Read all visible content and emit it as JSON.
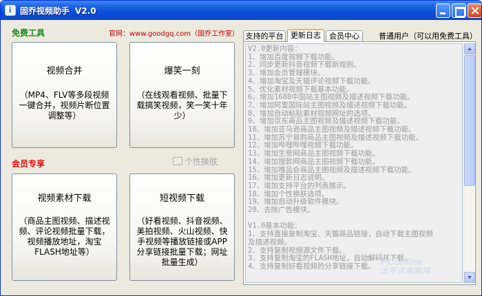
{
  "window": {
    "title": "固乔视频助手",
    "version": "V2.0"
  },
  "left": {
    "free_label": "免费工具",
    "site_text": "官网：www.goodgq.com（固乔工作室）",
    "vip_label": "会员专享",
    "skin_label": "个性换肤",
    "buttons": [
      {
        "title": "视频合并",
        "desc": "（MP4、FLV等多段视频一键合并，视频片断位置调整等）"
      },
      {
        "title": "爆笑一刻",
        "desc": "（在线观看视频、批量下载搞笑视频，笑一笑十年少）"
      },
      {
        "title": "视频素材下载",
        "desc": "（商品主图视频、描述视频、评论视频批量下载，视频播放地址，淘宝FLASH地址等）"
      },
      {
        "title": "短视频下载",
        "desc": "（好看视频、抖音视频、美拍视频、火山视频、快手视频等播放链接或APP分享链接批量下载；网址批量生成）"
      }
    ]
  },
  "tabs": [
    {
      "label": "支持的平台"
    },
    {
      "label": "更新日志"
    },
    {
      "label": "会员中心"
    }
  ],
  "user_status": "普通用户（可以用免费工具）",
  "changelog": [
    "V2.0更新内容：",
    "1、增加百度视频下载功能。",
    "2、同步更新抖音视频下载新规则。",
    "3、增加会员管理模块。",
    "4、增加淘宝及天猫评论视频下载功能。",
    "5、优化素材视频下载基本功能。",
    "6、增加1688中国站主图视频及描述视频下载功能。",
    "7、增加阿里国际站主图视频及描述视频下载功能。",
    "8、增加自动粘贴素材视频网址的选项。",
    "9、增加京东商品主图视频及描述视频下载功能。",
    "10、增加亚马逊商品主图视频及描述视频下载功能。",
    "11、增加苏宁易购商品主图视频及描述视频下载功能。",
    "12、增加哔哩哔哩视频下载功能。",
    "13、增加生意网商品主图视频下载功能。",
    "14、增加搜款网商品主图视频下载功能。",
    "15、增加唯品会商品主图视频及描述视频下载功能。",
    "16、增加更新日志说明。",
    "17、增加支持平台的列表展示。",
    "18、增加个性换肤选项。",
    "19、增加自动升级软件模块。",
    "20、去除广告模块。",
    "",
    "V1.0基本功能：",
    "1、支持直接复制淘宝、天猫商品链接，自动下载主图视频",
    "及描述视频。",
    "2、支持复制视频源文件下载。",
    "3、支持复制淘宝的FLASH地址，自动解码并下载。",
    "4、支持复制好看视频的分享链接下载。"
  ],
  "watermark": {
    "main": "PConline",
    "sub": "太平洋电脑网"
  },
  "colors": {
    "free_label": "#1a8c1a",
    "vip_label": "#e01010",
    "site_text": "#c00000",
    "titlebar": "#0a4fd8"
  }
}
